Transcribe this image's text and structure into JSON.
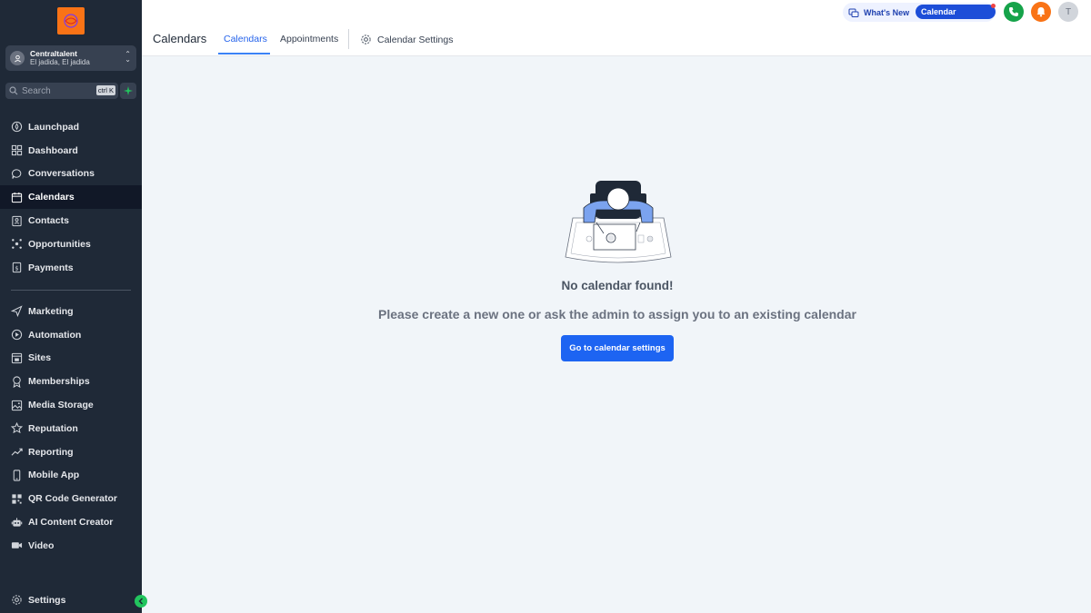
{
  "sidebar": {
    "account": {
      "name": "Centraltalent",
      "location": "El jadida, El jadida"
    },
    "search": {
      "placeholder": "Search",
      "shortcut": "ctrl K"
    },
    "items_primary": [
      {
        "label": "Launchpad",
        "icon": "rocket-icon"
      },
      {
        "label": "Dashboard",
        "icon": "grid-icon"
      },
      {
        "label": "Conversations",
        "icon": "chat-icon"
      },
      {
        "label": "Calendars",
        "icon": "calendar-icon",
        "active": true
      },
      {
        "label": "Contacts",
        "icon": "contacts-icon"
      },
      {
        "label": "Opportunities",
        "icon": "opportunities-icon"
      },
      {
        "label": "Payments",
        "icon": "payments-icon"
      }
    ],
    "items_secondary": [
      {
        "label": "Marketing",
        "icon": "send-icon"
      },
      {
        "label": "Automation",
        "icon": "automation-icon"
      },
      {
        "label": "Sites",
        "icon": "sites-icon"
      },
      {
        "label": "Memberships",
        "icon": "badge-icon"
      },
      {
        "label": "Media Storage",
        "icon": "image-icon"
      },
      {
        "label": "Reputation",
        "icon": "star-icon"
      },
      {
        "label": "Reporting",
        "icon": "trend-icon"
      },
      {
        "label": "Mobile App",
        "icon": "mobile-icon"
      },
      {
        "label": "QR Code Generator",
        "icon": "qr-icon"
      },
      {
        "label": "AI Content Creator",
        "icon": "robot-icon"
      },
      {
        "label": "Video",
        "icon": "video-icon"
      }
    ],
    "settings_label": "Settings"
  },
  "topbar": {
    "title": "Calendars",
    "tabs": [
      {
        "label": "Calendars",
        "active": true
      },
      {
        "label": "Appointments"
      }
    ],
    "settings_tab": "Calendar Settings",
    "whats_new": "What's New",
    "calendar_updates": "Calendar Updates",
    "avatar_initial": "T"
  },
  "main": {
    "empty_title": "No calendar found!",
    "empty_subtitle": "Please create a new one or ask the admin to assign you to an existing calendar",
    "cta_label": "Go to calendar settings"
  },
  "colors": {
    "sidebar_bg": "#1f2937",
    "accent": "#1d64f2",
    "phone": "#16a34a",
    "bell": "#f97316"
  }
}
